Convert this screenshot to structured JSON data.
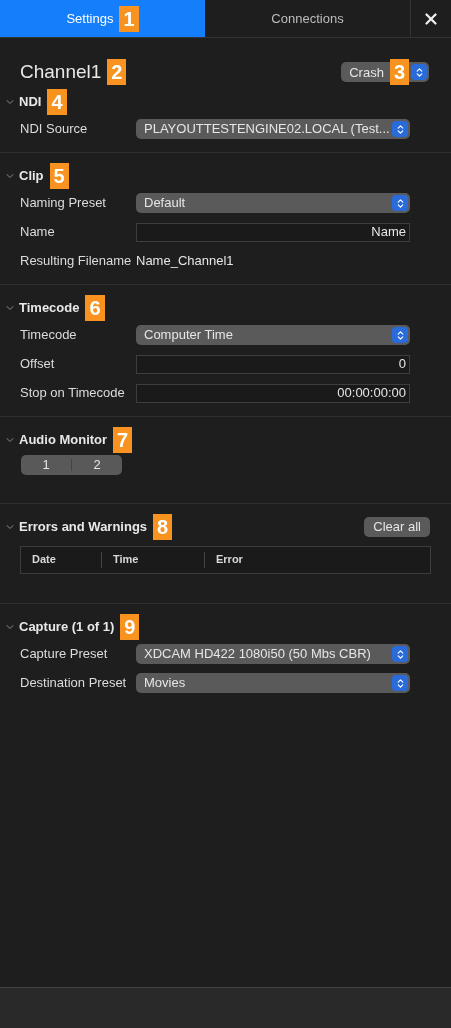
{
  "tabs": [
    {
      "label": "Settings",
      "selected": true,
      "marker": "1"
    },
    {
      "label": "Connections",
      "selected": false
    }
  ],
  "header": {
    "title": "Channel1",
    "title_marker": "2",
    "popup": "Crash",
    "popup_marker": "3"
  },
  "sections": [
    {
      "title": "NDI",
      "marker": "4",
      "expanded": true,
      "rows": [
        {
          "kind": "select",
          "label": "NDI Source",
          "value": "PLAYOUTTESTENGINE02.LOCAL (Test..."
        }
      ]
    },
    {
      "title": "Clip",
      "marker": "5",
      "expanded": true,
      "rows": [
        {
          "kind": "select",
          "label": "Naming Preset",
          "value": "Default"
        },
        {
          "kind": "field",
          "label": "Name",
          "placeholder": "Name"
        },
        {
          "kind": "text",
          "label": "Resulting Filename",
          "value": "Name_Channel1"
        }
      ]
    },
    {
      "title": "Timecode",
      "marker": "6",
      "expanded": true,
      "rows": [
        {
          "kind": "select",
          "label": "Timecode",
          "value": "Computer Time"
        },
        {
          "kind": "field",
          "label": "Offset",
          "value": "0"
        },
        {
          "kind": "field",
          "label": "Stop on Timecode",
          "value": "00:00:00:00"
        }
      ]
    },
    {
      "title": "Audio Monitor",
      "marker": "7",
      "expanded": true,
      "rows": [
        {
          "kind": "segmented",
          "segments": [
            {
              "label": "1",
              "selected": false
            },
            {
              "label": "2",
              "selected": false
            }
          ]
        }
      ]
    },
    {
      "title": "Errors and Warnings",
      "marker": "8",
      "expanded": true,
      "button": "Clear all",
      "rows": [
        {
          "kind": "table",
          "columns": [
            "Date",
            "Time",
            "Error"
          ]
        }
      ]
    },
    {
      "title": "Capture (1 of 1)",
      "marker": "9",
      "expanded": true,
      "rows": [
        {
          "kind": "select",
          "label": "Capture Preset",
          "value": "XDCAM HD422 1080i50 (50 Mbs CBR)"
        },
        {
          "kind": "select",
          "label": "Destination Preset",
          "value": "Movies"
        }
      ]
    }
  ]
}
